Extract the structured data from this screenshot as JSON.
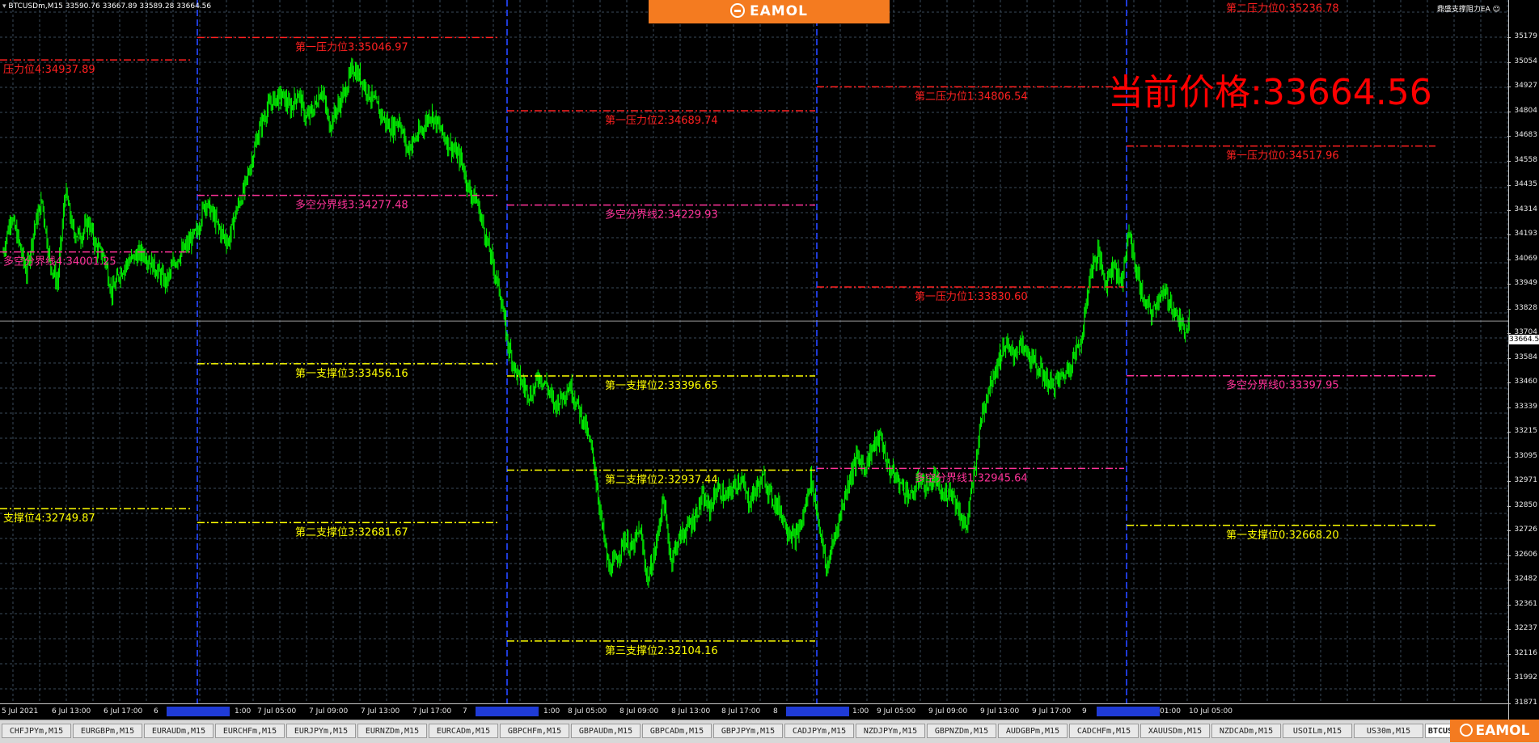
{
  "window": {
    "symbol_info": "BTCUSDm,M15  33590.76 33667.89 33589.28 33664.56",
    "ea_name": "鼎盛支撑阻力EA",
    "brand": "EAMOL"
  },
  "current_price": {
    "label_text": "当前价格:33664.56",
    "axis_tag": "33664.56",
    "value": 33664.56
  },
  "price_axis": {
    "labels": [
      "35179",
      "35054",
      "34927",
      "34804",
      "34683",
      "34558",
      "34435",
      "34314",
      "34193",
      "34069",
      "33949",
      "33828",
      "33704",
      "33584",
      "33460",
      "33339",
      "33215",
      "33095",
      "32971",
      "32850",
      "32726",
      "32606",
      "32482",
      "32361",
      "32237",
      "32116",
      "31992",
      "31871"
    ]
  },
  "time_axis": {
    "labels": [
      {
        "text": "5 Jul 2021"
      },
      {
        "text": "6 Jul 13:00"
      },
      {
        "text": "6 Jul 17:00"
      },
      {
        "text": "6"
      },
      {
        "text": "1:00"
      },
      {
        "text": "7 Jul 05:00"
      },
      {
        "text": "7 Jul 09:00"
      },
      {
        "text": "7 Jul 13:00"
      },
      {
        "text": "7 Jul 17:00"
      },
      {
        "text": "7"
      },
      {
        "text": "1:00"
      },
      {
        "text": "8 Jul 05:00"
      },
      {
        "text": "8 Jul 09:00"
      },
      {
        "text": "8 Jul 13:00"
      },
      {
        "text": "8 Jul 17:00"
      },
      {
        "text": "8"
      },
      {
        "text": "1:00"
      },
      {
        "text": "9 Jul 05:00"
      },
      {
        "text": "9 Jul 09:00"
      },
      {
        "text": "9 Jul 13:00"
      },
      {
        "text": "9 Jul 17:00"
      },
      {
        "text": "9"
      },
      {
        "text": "01:00"
      },
      {
        "text": "10 Jul 05:00"
      }
    ]
  },
  "levels": [
    {
      "label": "压力位4:34937.89",
      "price": 34937.89,
      "color": "#ff2020",
      "kind": "resistance"
    },
    {
      "label": "多空分界线4:34001.25",
      "price": 34001.25,
      "color": "#ff3399",
      "kind": "pivot"
    },
    {
      "label": "支撑位4:32749.87",
      "price": 32749.87,
      "color": "#ffff00",
      "kind": "support"
    },
    {
      "label": "第一压力位3:35046.97",
      "price": 35046.97,
      "color": "#ff2020",
      "kind": "resistance"
    },
    {
      "label": "多空分界线3:34277.48",
      "price": 34277.48,
      "color": "#ff3399",
      "kind": "pivot"
    },
    {
      "label": "第一支撑位3:33456.16",
      "price": 33456.16,
      "color": "#ffff00",
      "kind": "support"
    },
    {
      "label": "第二支撑位3:32681.67",
      "price": 32681.67,
      "color": "#ffff00",
      "kind": "support"
    },
    {
      "label": "第一压力位2:34689.74",
      "price": 34689.74,
      "color": "#ff2020",
      "kind": "resistance"
    },
    {
      "label": "多空分界线2:34229.93",
      "price": 34229.93,
      "color": "#ff3399",
      "kind": "pivot"
    },
    {
      "label": "第一支撑位2:33396.65",
      "price": 33396.65,
      "color": "#ffff00",
      "kind": "support"
    },
    {
      "label": "第二支撑位2:32937.44",
      "price": 32937.44,
      "color": "#ffff00",
      "kind": "support"
    },
    {
      "label": "第三支撑位2:32104.16",
      "price": 32104.16,
      "color": "#ffff00",
      "kind": "support"
    },
    {
      "label": "第二压力位1:34806.54",
      "price": 34806.54,
      "color": "#ff2020",
      "kind": "resistance"
    },
    {
      "label": "第一压力位1:33830.60",
      "price": 33830.6,
      "color": "#ff2020",
      "kind": "resistance"
    },
    {
      "label": "多空分界线1:32945.64",
      "price": 32945.64,
      "color": "#ff3399",
      "kind": "pivot"
    },
    {
      "label": "第二压力位0:35236.78",
      "price": 35236.78,
      "color": "#ff2020",
      "kind": "resistance"
    },
    {
      "label": "第一压力位0:34517.96",
      "price": 34517.96,
      "color": "#ff2020",
      "kind": "resistance"
    },
    {
      "label": "多空分界线0:33397.95",
      "price": 33397.95,
      "color": "#ff3399",
      "kind": "pivot"
    },
    {
      "label": "第一支撑位0:32668.20",
      "price": 32668.2,
      "color": "#ffff00",
      "kind": "support"
    }
  ],
  "tabs": [
    {
      "label": "CHFJPYm,M15",
      "active": false
    },
    {
      "label": "EURGBPm,M15",
      "active": false
    },
    {
      "label": "EURAUDm,M15",
      "active": false
    },
    {
      "label": "EURCHFm,M15",
      "active": false
    },
    {
      "label": "EURJPYm,M15",
      "active": false
    },
    {
      "label": "EURNZDm,M15",
      "active": false
    },
    {
      "label": "EURCADm,M15",
      "active": false
    },
    {
      "label": "GBPCHFm,M15",
      "active": false
    },
    {
      "label": "GBPAUDm,M15",
      "active": false
    },
    {
      "label": "GBPCADm,M15",
      "active": false
    },
    {
      "label": "GBPJPYm,M15",
      "active": false
    },
    {
      "label": "CADJPYm,M15",
      "active": false
    },
    {
      "label": "NZDJPYm,M15",
      "active": false
    },
    {
      "label": "GBPNZDm,M15",
      "active": false
    },
    {
      "label": "AUDGBPm,M15",
      "active": false
    },
    {
      "label": "CADCHFm,M15",
      "active": false
    },
    {
      "label": "XAUUSDm,M15",
      "active": false
    },
    {
      "label": "NZDCADm,M15",
      "active": false
    },
    {
      "label": "USOILm,M15",
      "active": false
    },
    {
      "label": "US30m,M15",
      "active": false
    },
    {
      "label": "BTCUSDm",
      "active": true
    }
  ],
  "chart_data": {
    "type": "candlestick",
    "symbol": "BTCUSDm",
    "timeframe": "M15",
    "grid": true,
    "colors": {
      "bull": "#00ff00",
      "bear": "#00ff00",
      "grid": "#3a4a5a",
      "separator": "#1f3bd6",
      "background": "#000000"
    },
    "ylim": [
      31800,
      35230
    ],
    "close_path": [
      [
        0,
        34000
      ],
      [
        8,
        34180
      ],
      [
        16,
        34050
      ],
      [
        24,
        33900
      ],
      [
        32,
        34120
      ],
      [
        40,
        34250
      ],
      [
        48,
        33950
      ],
      [
        56,
        33850
      ],
      [
        64,
        34300
      ],
      [
        72,
        34100
      ],
      [
        80,
        34080
      ],
      [
        88,
        34150
      ],
      [
        96,
        34020
      ],
      [
        104,
        33980
      ],
      [
        112,
        33800
      ],
      [
        120,
        33900
      ],
      [
        128,
        33950
      ],
      [
        136,
        33980
      ],
      [
        144,
        34000
      ],
      [
        152,
        33950
      ],
      [
        160,
        33900
      ],
      [
        168,
        33850
      ],
      [
        176,
        33950
      ],
      [
        184,
        34000
      ],
      [
        192,
        34050
      ],
      [
        200,
        34100
      ],
      [
        208,
        34250
      ],
      [
        216,
        34180
      ],
      [
        224,
        34100
      ],
      [
        232,
        34050
      ],
      [
        240,
        34200
      ],
      [
        248,
        34300
      ],
      [
        256,
        34450
      ],
      [
        264,
        34600
      ],
      [
        272,
        34700
      ],
      [
        280,
        34750
      ],
      [
        288,
        34760
      ],
      [
        296,
        34700
      ],
      [
        304,
        34780
      ],
      [
        312,
        34650
      ],
      [
        320,
        34700
      ],
      [
        328,
        34800
      ],
      [
        336,
        34620
      ],
      [
        344,
        34700
      ],
      [
        352,
        34780
      ],
      [
        360,
        34900
      ],
      [
        368,
        34850
      ],
      [
        376,
        34780
      ],
      [
        384,
        34720
      ],
      [
        392,
        34650
      ],
      [
        400,
        34600
      ],
      [
        408,
        34650
      ],
      [
        416,
        34500
      ],
      [
        424,
        34550
      ],
      [
        432,
        34600
      ],
      [
        440,
        34680
      ],
      [
        448,
        34620
      ],
      [
        456,
        34550
      ],
      [
        464,
        34500
      ],
      [
        472,
        34450
      ],
      [
        480,
        34300
      ],
      [
        488,
        34250
      ],
      [
        496,
        34100
      ],
      [
        504,
        33950
      ],
      [
        512,
        33800
      ],
      [
        520,
        33550
      ],
      [
        528,
        33420
      ],
      [
        536,
        33350
      ],
      [
        544,
        33300
      ],
      [
        552,
        33400
      ],
      [
        560,
        33350
      ],
      [
        568,
        33250
      ],
      [
        576,
        33300
      ],
      [
        584,
        33350
      ],
      [
        592,
        33250
      ],
      [
        600,
        33150
      ],
      [
        608,
        33000
      ],
      [
        616,
        32700
      ],
      [
        624,
        32450
      ],
      [
        632,
        32500
      ],
      [
        640,
        32600
      ],
      [
        648,
        32550
      ],
      [
        656,
        32650
      ],
      [
        664,
        32400
      ],
      [
        672,
        32550
      ],
      [
        680,
        32800
      ],
      [
        688,
        32500
      ],
      [
        696,
        32600
      ],
      [
        704,
        32650
      ],
      [
        712,
        32700
      ],
      [
        720,
        32800
      ],
      [
        728,
        32750
      ],
      [
        736,
        32850
      ],
      [
        744,
        32800
      ],
      [
        752,
        32850
      ],
      [
        760,
        32900
      ],
      [
        768,
        32780
      ],
      [
        776,
        32850
      ],
      [
        784,
        32900
      ],
      [
        792,
        32800
      ],
      [
        800,
        32750
      ],
      [
        808,
        32650
      ],
      [
        816,
        32600
      ],
      [
        824,
        32700
      ],
      [
        832,
        32900
      ],
      [
        840,
        32700
      ],
      [
        848,
        32450
      ],
      [
        856,
        32600
      ],
      [
        864,
        32750
      ],
      [
        872,
        32900
      ],
      [
        880,
        33000
      ],
      [
        888,
        32950
      ],
      [
        896,
        33050
      ],
      [
        904,
        33100
      ],
      [
        912,
        32950
      ],
      [
        920,
        32900
      ],
      [
        928,
        32850
      ],
      [
        936,
        32800
      ],
      [
        944,
        32900
      ],
      [
        952,
        32850
      ],
      [
        960,
        32900
      ],
      [
        968,
        32800
      ],
      [
        976,
        32850
      ],
      [
        984,
        32750
      ],
      [
        992,
        32650
      ],
      [
        1000,
        32900
      ],
      [
        1008,
        33200
      ],
      [
        1016,
        33350
      ],
      [
        1024,
        33450
      ],
      [
        1032,
        33550
      ],
      [
        1040,
        33500
      ],
      [
        1048,
        33550
      ],
      [
        1056,
        33500
      ],
      [
        1064,
        33450
      ],
      [
        1072,
        33400
      ],
      [
        1080,
        33350
      ],
      [
        1088,
        33380
      ],
      [
        1096,
        33420
      ],
      [
        1104,
        33500
      ],
      [
        1112,
        33600
      ],
      [
        1120,
        33900
      ],
      [
        1128,
        34000
      ],
      [
        1136,
        33850
      ],
      [
        1144,
        33950
      ],
      [
        1152,
        33850
      ],
      [
        1160,
        34100
      ],
      [
        1168,
        33900
      ],
      [
        1176,
        33750
      ],
      [
        1184,
        33700
      ],
      [
        1192,
        33800
      ],
      [
        1200,
        33780
      ],
      [
        1208,
        33700
      ],
      [
        1216,
        33620
      ],
      [
        1222,
        33664
      ]
    ]
  }
}
